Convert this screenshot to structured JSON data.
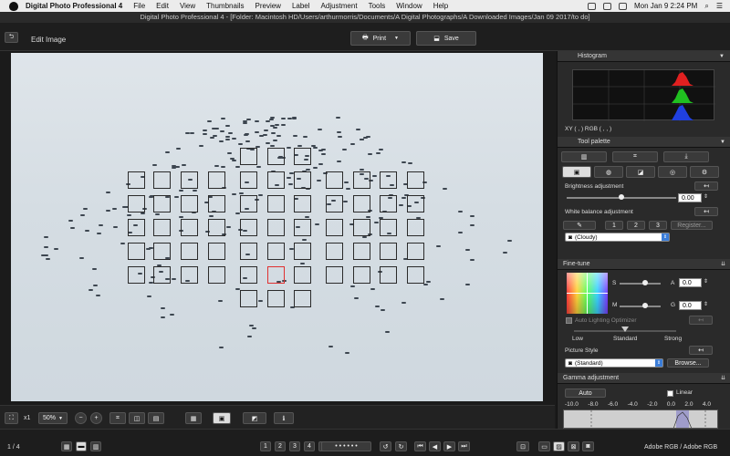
{
  "menubar": {
    "app_name": "Digital Photo Professional 4",
    "items": [
      "File",
      "Edit",
      "View",
      "Thumbnails",
      "Preview",
      "Label",
      "Adjustment",
      "Tools",
      "Window",
      "Help"
    ],
    "clock": "Mon Jan 9  2:24 PM"
  },
  "window": {
    "title": "Digital Photo Professional 4 - [Folder: Macintosh HD/Users/arthurmorris/Documents/A Digital Photographs/A Downloaded Images/Jan 09 2017/to do]"
  },
  "toolbar": {
    "edit_image_label": "Edit Image",
    "print_label": "Print",
    "save_label": "Save"
  },
  "viewer": {
    "zoom_label": "x1",
    "zoom_value": "50%"
  },
  "status": {
    "page_count": "1 / 4",
    "color_space": "Adobe RGB / Adobe RGB",
    "rating_buttons": [
      "1",
      "2",
      "3",
      "4",
      "5"
    ]
  },
  "histogram": {
    "title": "Histogram",
    "xy_label": "XY (        ,        )  RGB (        ,        ,        )"
  },
  "tool_palette": {
    "title": "Tool palette",
    "brightness_label": "Brightness adjustment",
    "brightness_value": "0.00",
    "brightness_level": 0.5,
    "wb_label": "White balance adjustment",
    "wb_presets": [
      "1",
      "2",
      "3"
    ],
    "register_label": "Register...",
    "wb_value": "(Cloudy)",
    "finetune_title": "Fine-tune",
    "s_label": "S",
    "m_label": "M",
    "a_label": "A",
    "g_label": "G",
    "a_value": "0.0",
    "g_value": "0.0",
    "alo_label": "Auto Lighting Optimizer",
    "alo_levels": [
      "Low",
      "Standard",
      "Strong"
    ],
    "picture_style_label": "Picture Style",
    "picture_style_value": "(Standard)",
    "browse_label": "Browse...",
    "gamma_title": "Gamma adjustment",
    "auto_label": "Auto",
    "linear_label": "Linear",
    "gamma_ticks": [
      "-10.0",
      "-8.0",
      "-6.0",
      "-4.0",
      "-2.0",
      "0.0",
      "2.0",
      "4.0"
    ]
  },
  "colors": {
    "accent_blue": "#3b7dd8",
    "af_active": "#e03030",
    "hist_red": "#e02020",
    "hist_green": "#20c020",
    "hist_blue": "#2040e0"
  }
}
